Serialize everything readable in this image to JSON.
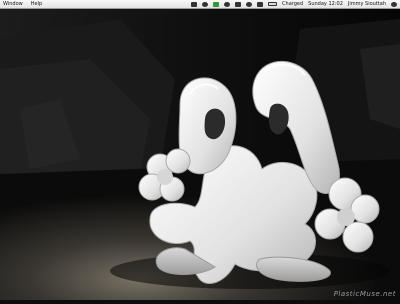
{
  "menubar": {
    "left": [
      "Window",
      "Help"
    ],
    "battery_status": "Charged",
    "clock": "Sunday 12:02",
    "user": "Jimmy Siouttah"
  },
  "desktop": {
    "wallpaper": "dark 3D scene with white glossy graffiti character",
    "watermark": "PlasticMuse.net"
  },
  "colors": {
    "menubar": "#ebebeb",
    "sculpture": "#e6e6e6",
    "background": "#0d0d0d"
  }
}
